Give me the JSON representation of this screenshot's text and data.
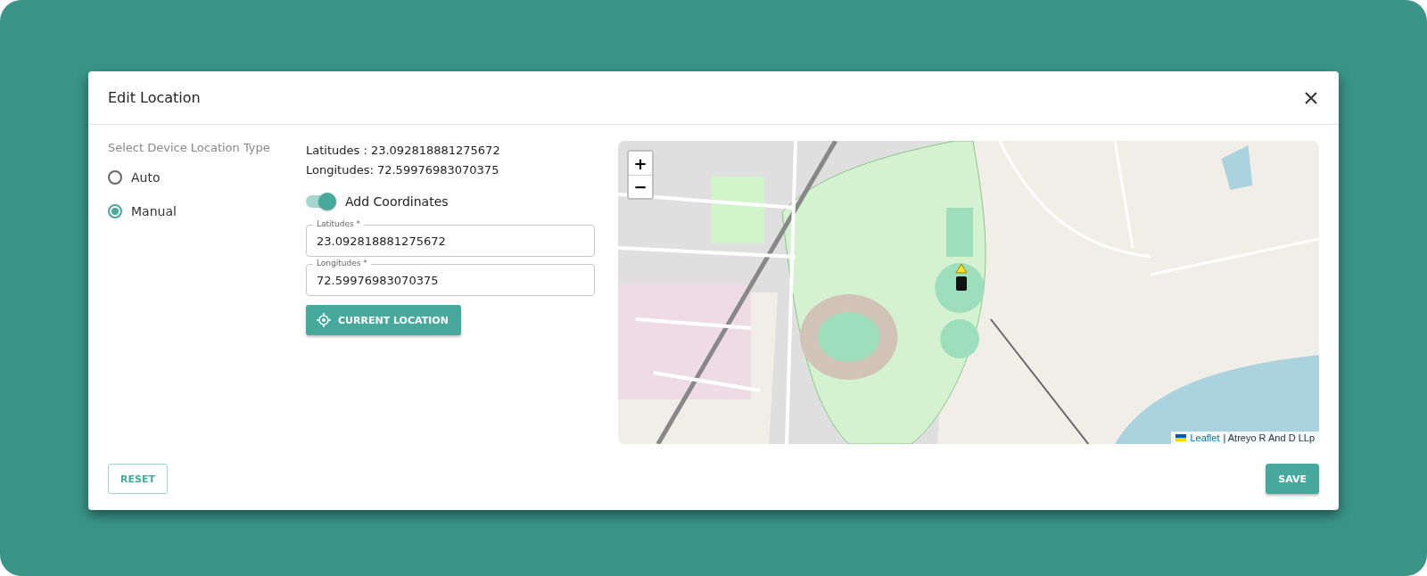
{
  "dialog": {
    "title": "Edit Location"
  },
  "location_type": {
    "label": "Select Device Location Type",
    "options": [
      {
        "label": "Auto",
        "selected": false
      },
      {
        "label": "Manual",
        "selected": true
      }
    ]
  },
  "coordinates": [
    "Latitudes : 23.092818881275672",
    "Longitudes: 72.59976983070375"
  ],
  "toggle": {
    "label": "Add Coordinates",
    "on": true
  },
  "fields": [
    {
      "label": "Latitudes *",
      "value": "23.092818881275672"
    },
    {
      "label": "Longitudes *",
      "value": "72.59976983070375"
    }
  ],
  "current_location_button": "CURRENT LOCATION",
  "map": {
    "zoom_in": "+",
    "zoom_out": "−",
    "attribution_link": "Leaflet",
    "attribution_text": "| Atreyo R And D LLp"
  },
  "footer_buttons": [
    {
      "label": "RESET",
      "kind": "outlined"
    },
    {
      "label": "SAVE",
      "kind": "filled"
    }
  ]
}
